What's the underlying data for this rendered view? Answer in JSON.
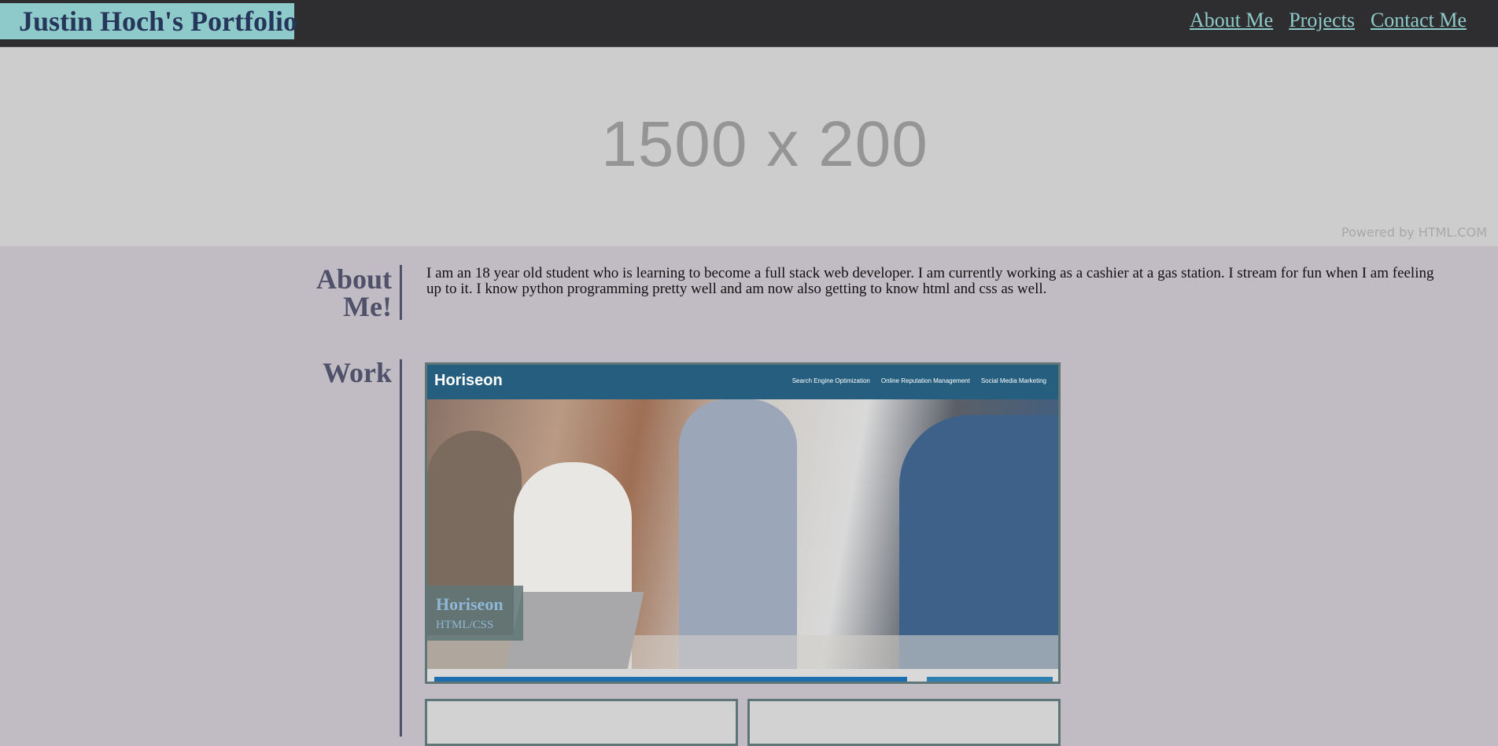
{
  "header": {
    "brand": "Justin Hoch's Portfolio",
    "nav": [
      "About Me",
      "Projects",
      "Contact Me"
    ]
  },
  "hero": {
    "placeholder_text": "1500 x 200",
    "powered_by": "Powered by HTML.COM"
  },
  "about": {
    "title_line1": "About",
    "title_line2": "Me!",
    "text": "I am an 18 year old student who is learning to become a full stack web developer. I am currently working as a cashier at a gas station. I stream for fun when I am feeling up to it. I know python programming pretty well and am now also getting to know html and css as well."
  },
  "work": {
    "title": "Work",
    "featured": {
      "screenshot": {
        "logo": "Horiseon",
        "links": [
          "Search Engine Optimization",
          "Online Reputation Management",
          "Social Media Marketing"
        ]
      },
      "name": "Horiseon",
      "tech": "HTML/CSS"
    }
  },
  "colors": {
    "header_bg": "#2e2e30",
    "brand_bg": "#8fcaca",
    "brand_text": "#26355a",
    "page_bg": "#c1bcc3",
    "section_title": "#4f5069",
    "card_border": "#5f7676"
  }
}
